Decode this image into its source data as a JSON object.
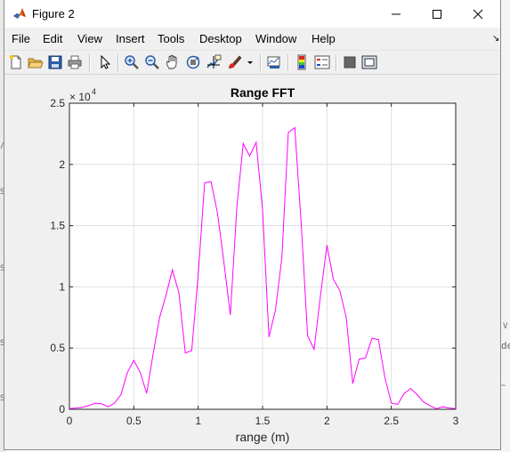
{
  "window": {
    "title": "Figure 2",
    "controls": {
      "minimize": "—",
      "maximize": "☐",
      "close": "✕"
    }
  },
  "menu": [
    "File",
    "Edit",
    "View",
    "Insert",
    "Tools",
    "Desktop",
    "Window",
    "Help"
  ],
  "menu_dock_glyph": "↘",
  "toolbar": [
    "new-figure-icon",
    "open-file-icon",
    "save-icon",
    "print-icon",
    "pointer-icon",
    "zoom-in-icon",
    "zoom-out-icon",
    "pan-icon",
    "rotate-3d-icon",
    "data-cursor-icon",
    "brush-icon",
    "brush-dropdown-icon",
    "link-plot-icon",
    "insert-colorbar-icon",
    "insert-legend-icon",
    "hide-plot-tools-icon",
    "show-plot-tools-icon"
  ],
  "colors": {
    "line": "#ff00ff",
    "grid": "#dfdfdf",
    "axes": "#262626",
    "window_bg": "#f0f0f0"
  },
  "chart_data": {
    "type": "line",
    "title": "Range FFT",
    "xlabel": "range (m)",
    "ylabel": "",
    "xlim": [
      0,
      3
    ],
    "ylim": [
      0,
      25000
    ],
    "y_exponent_label": "× 10",
    "y_exponent": "4",
    "xticks": [
      0,
      0.5,
      1,
      1.5,
      2,
      2.5,
      3
    ],
    "xtick_labels": [
      "0",
      "0.5",
      "1",
      "1.5",
      "2",
      "2.5",
      "3"
    ],
    "yticks": [
      0,
      5000,
      10000,
      15000,
      20000,
      25000
    ],
    "ytick_labels": [
      "0",
      "0.5",
      "1",
      "1.5",
      "2",
      "2.5"
    ],
    "grid": true,
    "series": [
      {
        "color": "#ff00ff",
        "x": [
          0,
          0.05,
          0.1,
          0.15,
          0.2,
          0.25,
          0.3,
          0.35,
          0.4,
          0.45,
          0.5,
          0.55,
          0.6,
          0.65,
          0.7,
          0.75,
          0.8,
          0.85,
          0.9,
          0.95,
          1.0,
          1.05,
          1.1,
          1.15,
          1.2,
          1.25,
          1.3,
          1.35,
          1.4,
          1.45,
          1.5,
          1.55,
          1.6,
          1.65,
          1.7,
          1.75,
          1.8,
          1.85,
          1.9,
          1.95,
          2.0,
          2.05,
          2.1,
          2.15,
          2.2,
          2.25,
          2.3,
          2.35,
          2.4,
          2.45,
          2.5,
          2.55,
          2.6,
          2.65,
          2.7,
          2.75,
          2.8,
          2.85,
          2.9,
          2.95,
          3.0
        ],
        "y": [
          50,
          100,
          150,
          300,
          500,
          450,
          200,
          500,
          1200,
          3000,
          4000,
          3000,
          1300,
          4500,
          7500,
          9300,
          11400,
          9500,
          4600,
          4800,
          11000,
          18500,
          18600,
          16000,
          12000,
          7700,
          16500,
          21700,
          20700,
          21800,
          16300,
          5900,
          8100,
          12400,
          22600,
          23000,
          15200,
          6000,
          4900,
          9300,
          13400,
          10600,
          9700,
          7500,
          2100,
          4100,
          4200,
          5800,
          5700,
          2600,
          500,
          400,
          1300,
          1700,
          1200,
          600,
          300,
          50,
          200,
          100,
          50
        ]
      }
    ]
  }
}
